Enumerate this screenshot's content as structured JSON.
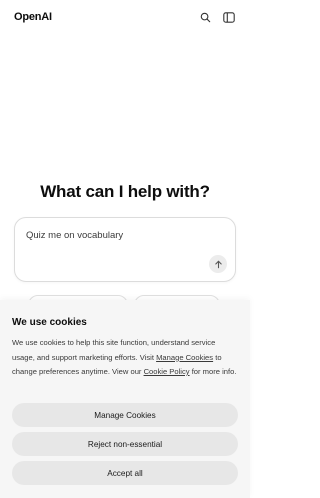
{
  "header": {
    "logo": "OpenAI",
    "search_icon": "search-icon",
    "sidebar_icon": "sidebar-toggle-icon"
  },
  "main": {
    "heading": "What can I help with?",
    "composer_text": "Quiz me on vocabulary",
    "send_icon": "arrow-up-icon"
  },
  "cookies": {
    "title": "We use cookies",
    "text_before_manage": "We use cookies to help this site function, understand service usage, and support marketing efforts. Visit ",
    "manage_link": "Manage Cookies",
    "text_middle": " to change preferences anytime. View our ",
    "policy_link": "Cookie Policy",
    "text_after": " for more info.",
    "buttons": {
      "manage": "Manage Cookies",
      "reject": "Reject non-essential",
      "accept": "Accept all"
    }
  },
  "colors": {
    "background": "#ffffff",
    "overlay": "#f6f6f6",
    "button": "#e7e7e7",
    "text": "#0d0d0d"
  }
}
